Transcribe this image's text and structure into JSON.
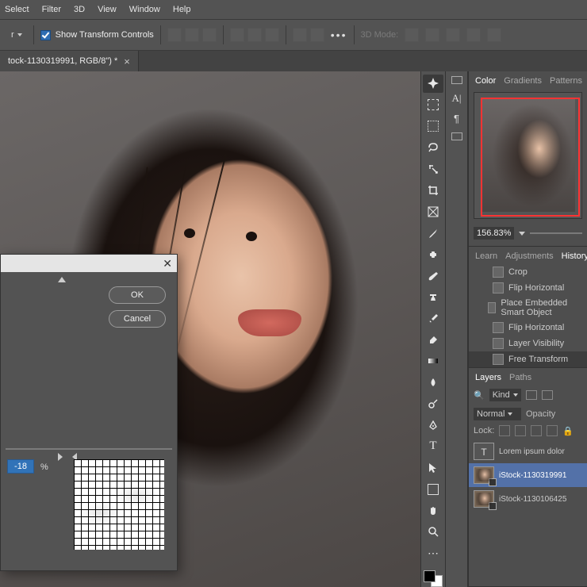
{
  "menu": {
    "items": [
      "Select",
      "Filter",
      "3D",
      "View",
      "Window",
      "Help"
    ]
  },
  "options_bar": {
    "layer_dropdown": "r",
    "show_transform_controls": "Show Transform Controls",
    "mode_label": "3D Mode:"
  },
  "doc_tab": {
    "title": "tock-1130319991, RGB/8\") *"
  },
  "dialog": {
    "ok": "OK",
    "cancel": "Cancel",
    "value": "-18",
    "unit": "%"
  },
  "right": {
    "color_tabs": [
      "Color",
      "Gradients",
      "Patterns"
    ],
    "zoom": "156.83%",
    "learn_tabs": [
      "Learn",
      "Adjustments",
      "History"
    ],
    "history": [
      {
        "label": "Crop"
      },
      {
        "label": "Flip Horizontal"
      },
      {
        "label": "Place Embedded Smart Object"
      },
      {
        "label": "Flip Horizontal"
      },
      {
        "label": "Layer Visibility"
      },
      {
        "label": "Free Transform"
      }
    ],
    "layers_tabs": [
      "Layers",
      "Paths"
    ],
    "kind_label": "Kind",
    "blend_mode": "Normal",
    "opacity_label": "Opacity",
    "lock_label": "Lock:",
    "layers": [
      {
        "type": "text",
        "name": "Lorem ipsum dolor"
      },
      {
        "type": "smart",
        "name": "iStock-1130319991"
      },
      {
        "type": "smart",
        "name": "iStock-1130106425"
      }
    ]
  },
  "tool_names": [
    "move",
    "artboard",
    "marquee",
    "lasso",
    "quick-select",
    "crop",
    "frame",
    "eyedropper",
    "heal",
    "brush",
    "clone",
    "history-brush",
    "eraser",
    "gradient",
    "blur",
    "dodge",
    "pen",
    "type",
    "path-select",
    "rectangle",
    "hand",
    "zoom"
  ]
}
